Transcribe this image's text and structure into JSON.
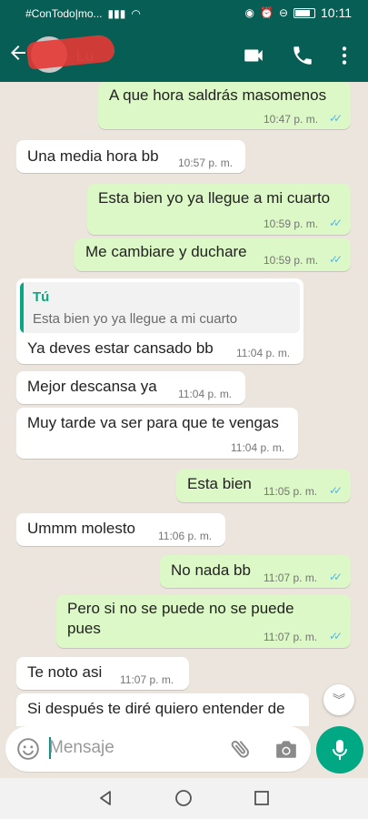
{
  "status": {
    "carrier": "#ConTodo|mo...",
    "time": "10:11"
  },
  "header": {
    "contact_name": "Lu"
  },
  "messages": [
    {
      "dir": "out",
      "text": "A que hora saldrás masomenos",
      "time": "10:47 p. m."
    },
    {
      "dir": "in",
      "text": "Una media hora bb",
      "time": "10:57 p. m."
    },
    {
      "dir": "out",
      "text": "Esta bien yo ya llegue a mi cuarto",
      "time": "10:59 p. m."
    },
    {
      "dir": "out",
      "text": "Me cambiare y duchare",
      "time": "10:59 p. m."
    },
    {
      "dir": "in",
      "quote_author": "Tú",
      "quote_text": "Esta bien yo ya llegue a mi cuarto",
      "text": "Ya deves estar cansado bb",
      "time": "11:04 p. m."
    },
    {
      "dir": "in",
      "text": "Mejor descansa ya",
      "time": "11:04 p. m."
    },
    {
      "dir": "in",
      "text": "Muy tarde va ser para que te vengas",
      "time": "11:04 p. m."
    },
    {
      "dir": "out",
      "text": "Esta bien",
      "time": "11:05 p. m."
    },
    {
      "dir": "in",
      "text": "Ummm molesto",
      "time": "11:06 p. m."
    },
    {
      "dir": "out",
      "text": "No nada bb",
      "time": "11:07 p. m."
    },
    {
      "dir": "out",
      "text_line1": "Pero si no se puede no se puede",
      "text_line2": "pues",
      "time": "11:07 p. m."
    },
    {
      "dir": "in",
      "text": "Te noto asi",
      "time": "11:07 p. m."
    },
    {
      "dir": "in",
      "text": "Si después te diré quiero entender de"
    }
  ],
  "composer": {
    "placeholder": "Mensaje"
  },
  "colors": {
    "header": "#075e54",
    "outgoing": "#dcf8c6",
    "incoming": "#ffffff",
    "accent": "#00a884",
    "read_ticks": "#4fb6ec"
  },
  "icons": {
    "back": "arrow-left-icon",
    "video": "video-camera-icon",
    "call": "phone-icon",
    "menu": "more-vertical-icon",
    "emoji": "emoji-icon",
    "attach": "paperclip-icon",
    "camera": "camera-icon",
    "mic": "microphone-icon",
    "scroll": "chevron-double-down-icon"
  }
}
